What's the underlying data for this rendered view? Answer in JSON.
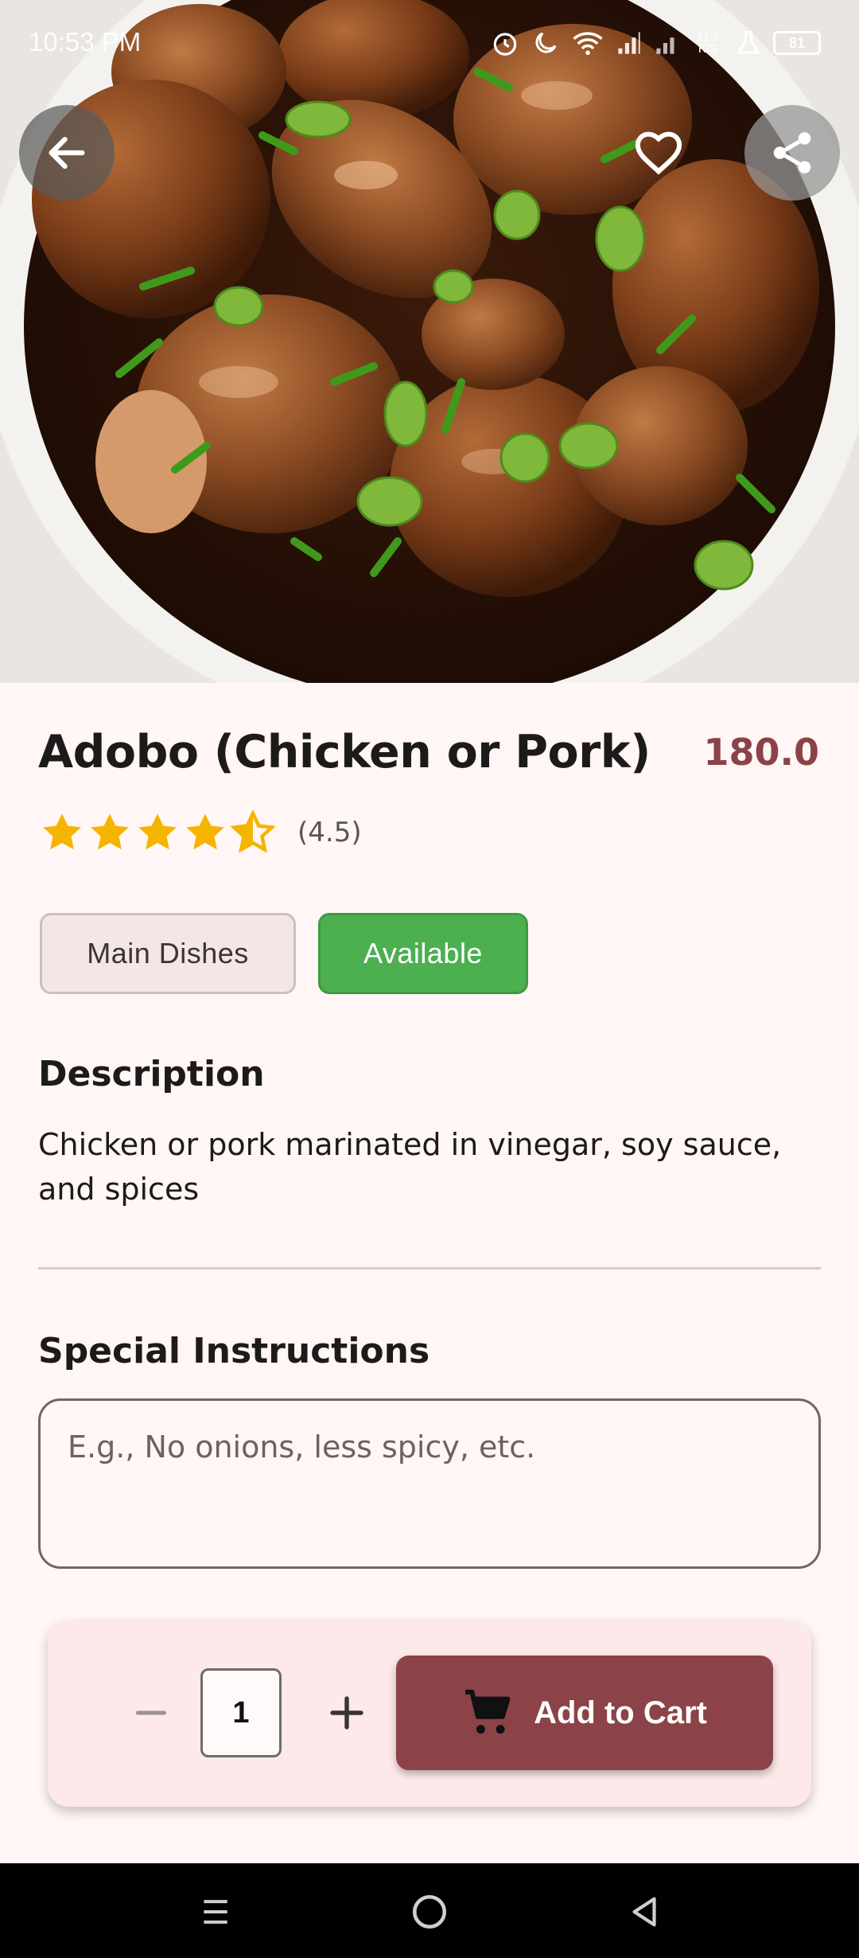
{
  "status_bar": {
    "time": "10:53 PM",
    "net_speed": "11.2 K/S",
    "battery": "81"
  },
  "hero": {
    "image_icon": "food-photo",
    "back_icon": "arrow-left-icon",
    "favorite_icon": "heart-outline-icon",
    "share_icon": "share-icon"
  },
  "product": {
    "name": "Adobo (Chicken or Pork)",
    "price": "180.0",
    "rating_value": 4.5,
    "rating_label": "(4.5)",
    "category": "Main Dishes",
    "availability": "Available"
  },
  "description": {
    "heading": "Description",
    "text": "Chicken or pork marinated in vinegar, soy sauce, and spices"
  },
  "instructions": {
    "heading": "Special Instructions",
    "placeholder": "E.g., No onions, less spicy, etc.",
    "value": ""
  },
  "cart": {
    "quantity": "1",
    "add_label": "Add to Cart",
    "minus_icon": "minus-icon",
    "plus_icon": "plus-icon",
    "cart_icon": "cart-icon"
  },
  "colors": {
    "accent": "#8b4347",
    "available": "#4caf50",
    "star": "#f5b400",
    "background": "#fff6f5"
  }
}
